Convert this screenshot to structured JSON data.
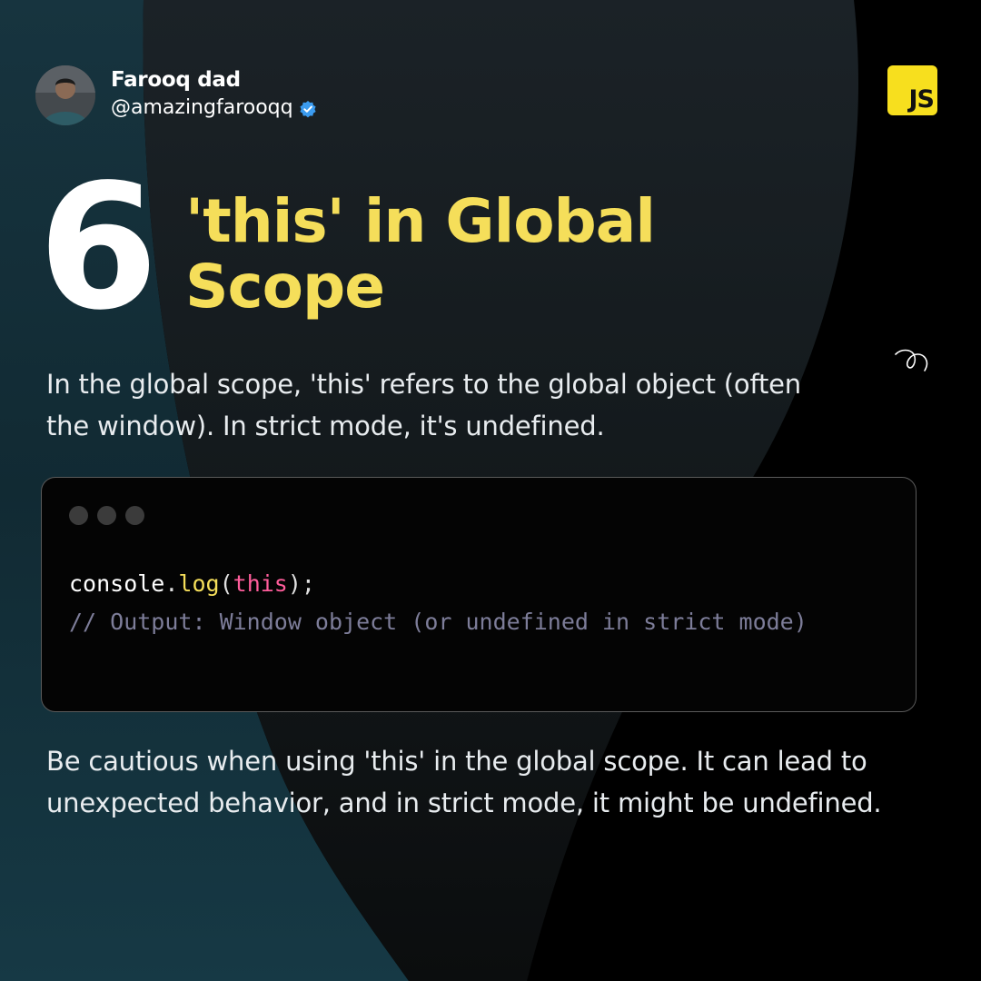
{
  "author": {
    "name": "Farooq dad",
    "handle": "@amazingfarooqq",
    "avatar_icon": "profile-photo",
    "verified_icon": "verified-badge-icon",
    "verified_color": "#3b9cf0"
  },
  "badge": {
    "label": "JS",
    "color": "#f7df1e"
  },
  "step": {
    "number": "6",
    "title": "'this' in Global Scope"
  },
  "intro": "In the global scope, 'this' refers to the global object (often the window). In strict mode, it's undefined.",
  "code": {
    "tokens": {
      "obj": "console",
      "dot": ".",
      "method": "log",
      "open": "(",
      "arg": "this",
      "close": ");",
      "comment": "// Output: Window object (or undefined in strict mode)"
    }
  },
  "note": "Be cautious when using 'this' in the global scope. It can lead to unexpected behavior, and in strict mode, it might be undefined.",
  "colors": {
    "accent_yellow": "#f5de5a",
    "keyword_pink": "#ff5d9b",
    "comment_gray": "#7d7d99",
    "background_teal": "#16323c"
  }
}
